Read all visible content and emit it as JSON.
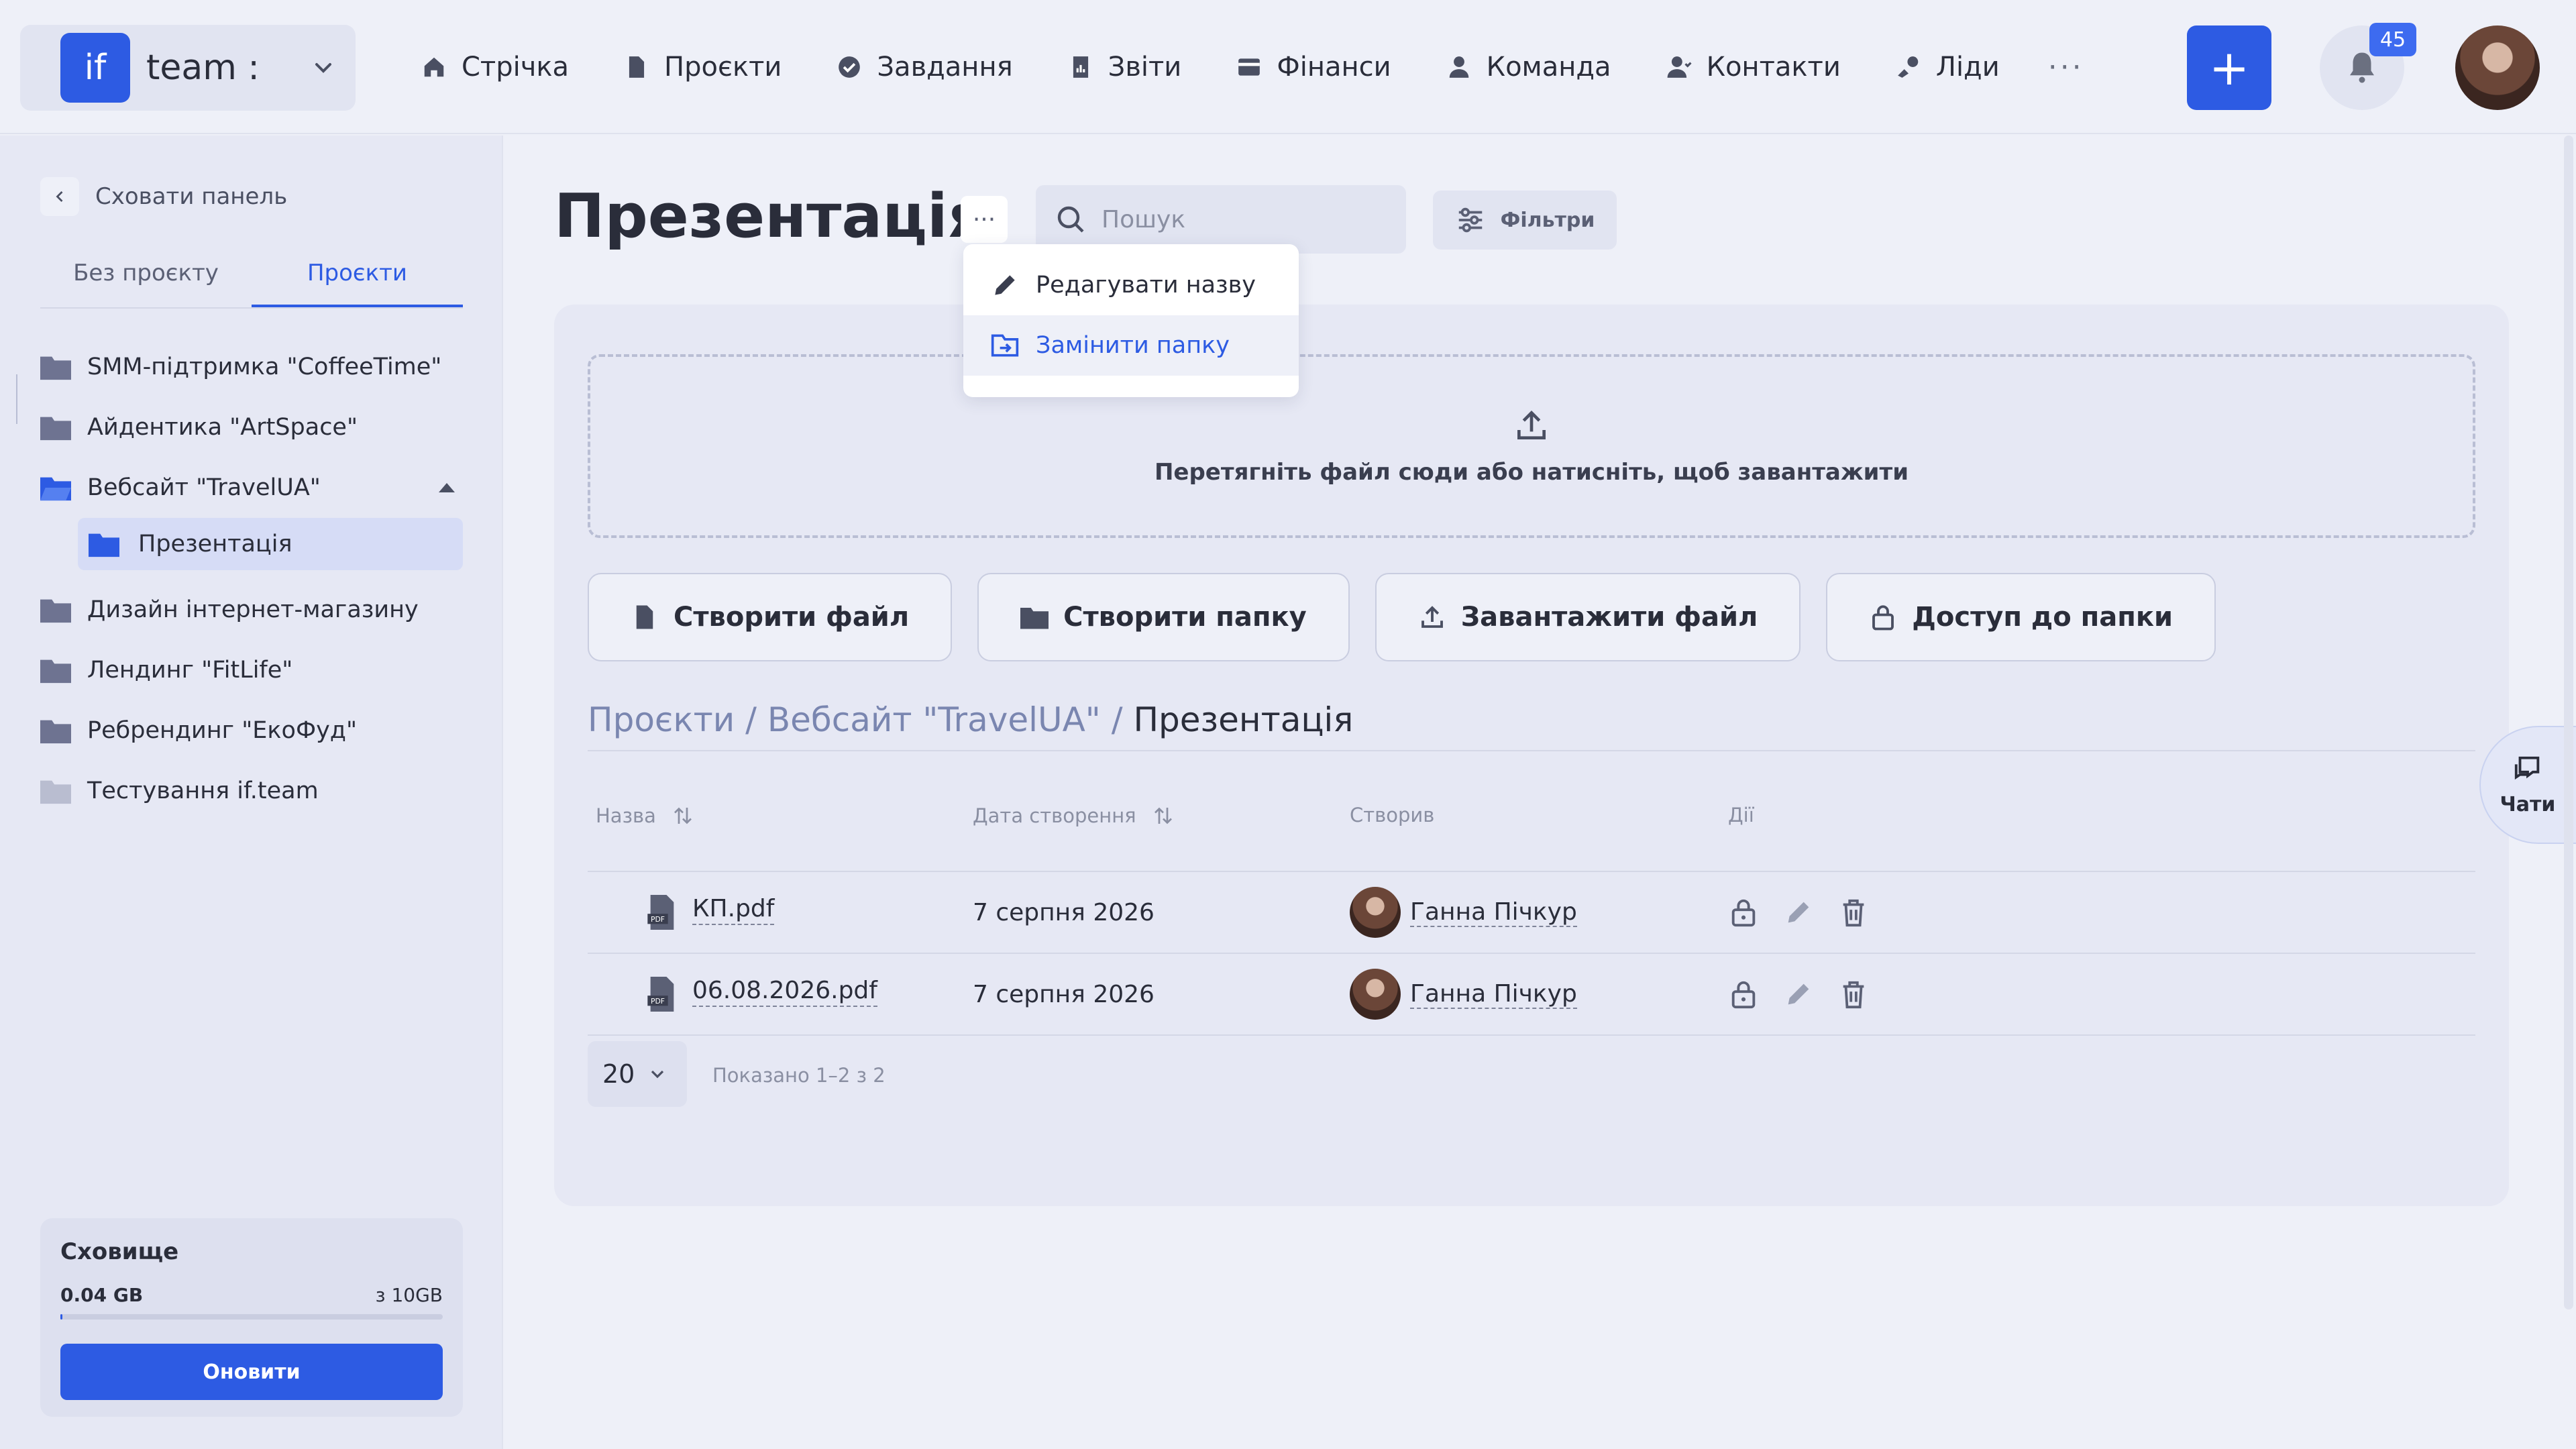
{
  "colors": {
    "accent": "#2d5be3",
    "background": "#eef0f8",
    "sidebar": "#e6e8f4",
    "muted": "#8a8fa2"
  },
  "brand": {
    "logo_text": "if",
    "name": "team :"
  },
  "nav": [
    {
      "label": "Стрічка",
      "icon": "home-icon"
    },
    {
      "label": "Проєкти",
      "icon": "file-icon"
    },
    {
      "label": "Завдання",
      "icon": "check-circle-icon"
    },
    {
      "label": "Звіти",
      "icon": "report-icon"
    },
    {
      "label": "Фінанси",
      "icon": "wallet-icon"
    },
    {
      "label": "Команда",
      "icon": "user-icon"
    },
    {
      "label": "Контакти",
      "icon": "contacts-icon"
    },
    {
      "label": "Ліди",
      "icon": "leads-icon"
    }
  ],
  "nav_more": "···",
  "header": {
    "add_label": "+",
    "notifications_count": "45"
  },
  "sidebar": {
    "hide_panel": "Сховати панель",
    "tabs": [
      "Без проєкту",
      "Проєкти"
    ],
    "active_tab": 1,
    "projects": [
      "SMM-підтримка \"CoffeeTime\"",
      "Айдентика \"ArtSpace\"",
      "Вебсайт \"TravelUA\"",
      "Дизайн інтернет-магазину",
      "Лендинг \"FitLife\"",
      "Ребрендинг \"ЕкоФуд\"",
      "Тестування if.team"
    ],
    "expanded_child": "Презентація",
    "storage": {
      "title": "Сховище",
      "used": "0.04 GB",
      "total": "з 10GB",
      "fraction": 0.004,
      "upgrade": "Оновити"
    }
  },
  "main": {
    "title": "Презентація",
    "more": "···",
    "search_placeholder": "Пошук",
    "filters": "Фільтри",
    "menu": [
      "Редагувати назву",
      "Замінити папку"
    ],
    "dropzone": "Перетягніть файл сюди або натисніть, щоб завантажити",
    "actions": [
      "Створити файл",
      "Створити папку",
      "Завантажити файл",
      "Доступ до папки"
    ],
    "breadcrumb": {
      "path": "Проєкти / Вебсайт \"TravelUA\" / ",
      "current": "Презентація"
    },
    "columns": [
      "Назва",
      "Дата створення",
      "Створив",
      "Дії"
    ],
    "rows": [
      {
        "name": "КП.pdf",
        "date": "7 серпня 2026",
        "author": "Ганна Пічкур"
      },
      {
        "name": "06.08.2026.pdf",
        "date": "7 серпня 2026",
        "author": "Ганна Пічкур"
      }
    ],
    "page_size": "20",
    "shown": "Показано 1–2 з 2"
  },
  "chats": "Чати"
}
